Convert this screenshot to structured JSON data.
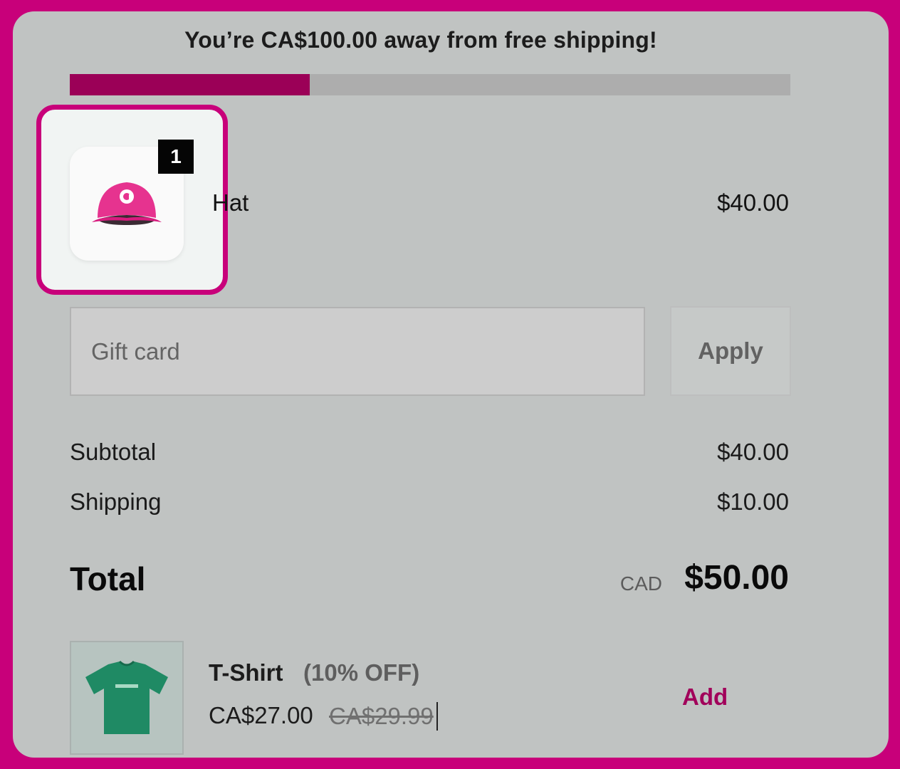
{
  "banner": {
    "text": "You’re CA$100.00 away from free shipping!"
  },
  "progress": {
    "fraction": 0.333
  },
  "cart_item": {
    "quantity": "1",
    "name": "Hat",
    "price": "$40.00",
    "image_icon": "pink-cap-icon"
  },
  "gift_card": {
    "placeholder": "Gift card",
    "apply_label": "Apply"
  },
  "summary": {
    "subtotal_label": "Subtotal",
    "subtotal_value": "$40.00",
    "shipping_label": "Shipping",
    "shipping_value": "$10.00",
    "total_label": "Total",
    "total_currency": "CAD",
    "total_value": "$50.00"
  },
  "upsell": {
    "name": "T-Shirt",
    "discount": "(10% OFF)",
    "price": "CA$27.00",
    "compare_price": "CA$29.99",
    "add_label": "Add",
    "image_icon": "green-tshirt-icon"
  },
  "colors": {
    "accent": "#c8007a",
    "progress_fill": "#9b0057",
    "add_link": "#a1005a"
  }
}
